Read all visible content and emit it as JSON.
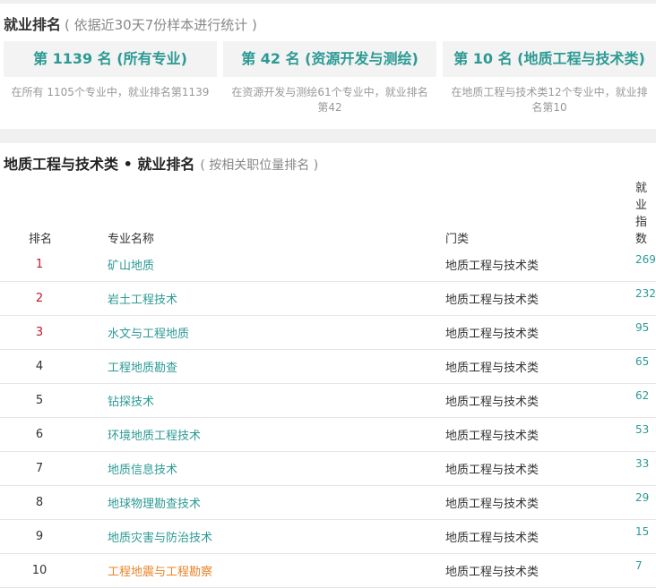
{
  "section": {
    "title": "就业排名",
    "subtitle": "( 依据近30天7份样本进行统计 )"
  },
  "cards": [
    {
      "headline": "第 1139 名 (所有专业)",
      "desc": "在所有 1105个专业中，就业排名第1139"
    },
    {
      "headline": "第 42 名 (资源开发与测绘)",
      "desc": "在资源开发与测绘61个专业中，就业排名第42"
    },
    {
      "headline": "第 10 名 (地质工程与技术类)",
      "desc": "在地质工程与技术类12个专业中，就业排名第10"
    }
  ],
  "ranking": {
    "title": "地质工程与技术类 • 就业排名",
    "subtitle": "( 按相关职位量排名 )",
    "headers": {
      "rank": "排名",
      "name": "专业名称",
      "category": "门类",
      "score": "就业指数"
    },
    "rows": [
      {
        "rank": "1",
        "name": "矿山地质",
        "category": "地质工程与技术类",
        "score": "269"
      },
      {
        "rank": "2",
        "name": "岩土工程技术",
        "category": "地质工程与技术类",
        "score": "232"
      },
      {
        "rank": "3",
        "name": "水文与工程地质",
        "category": "地质工程与技术类",
        "score": "95"
      },
      {
        "rank": "4",
        "name": "工程地质勘查",
        "category": "地质工程与技术类",
        "score": "65"
      },
      {
        "rank": "5",
        "name": "钻探技术",
        "category": "地质工程与技术类",
        "score": "62"
      },
      {
        "rank": "6",
        "name": "环境地质工程技术",
        "category": "地质工程与技术类",
        "score": "53"
      },
      {
        "rank": "7",
        "name": "地质信息技术",
        "category": "地质工程与技术类",
        "score": "33"
      },
      {
        "rank": "8",
        "name": "地球物理勘查技术",
        "category": "地质工程与技术类",
        "score": "29"
      },
      {
        "rank": "9",
        "name": "地质灾害与防治技术",
        "category": "地质工程与技术类",
        "score": "15"
      },
      {
        "rank": "10",
        "name": "工程地震与工程勘察",
        "category": "地质工程与技术类",
        "score": "7"
      }
    ]
  },
  "colors": {
    "accent": "#2c9a94",
    "top_rank": "#c3182c",
    "current": "#e8842a"
  }
}
